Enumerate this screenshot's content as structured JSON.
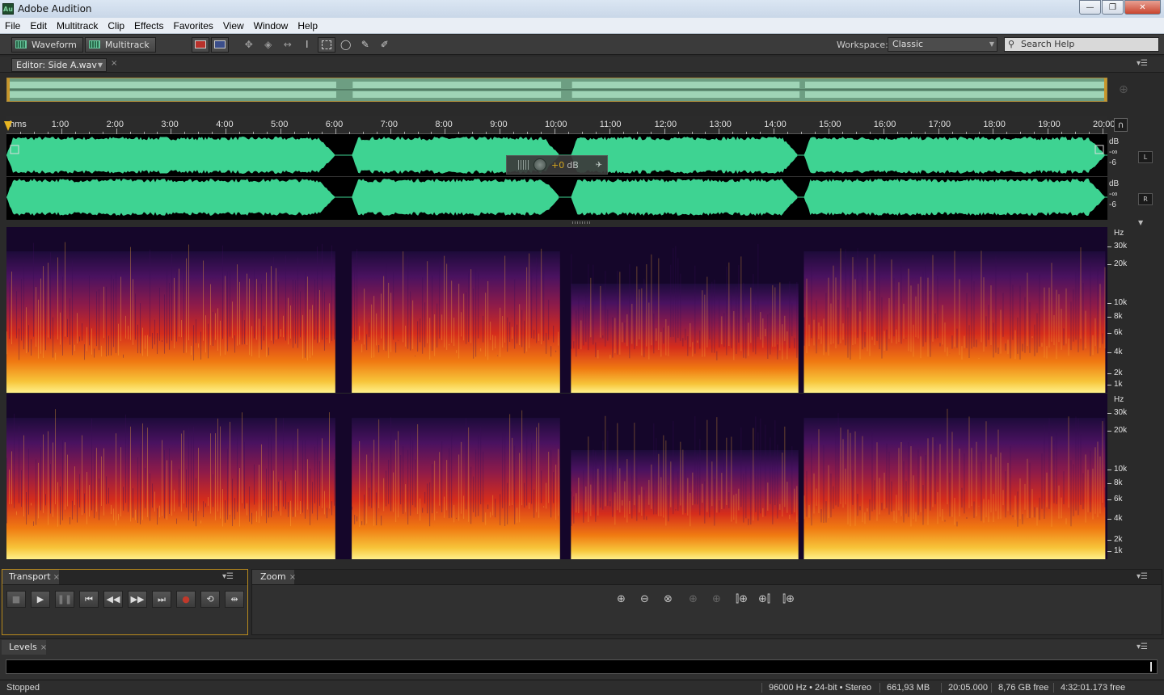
{
  "window": {
    "title": "Adobe Audition",
    "icon_text": "Au",
    "minimize": "—",
    "maximize": "❐",
    "close": "✕"
  },
  "menu": [
    "File",
    "Edit",
    "Multitrack",
    "Clip",
    "Effects",
    "Favorites",
    "View",
    "Window",
    "Help"
  ],
  "toolbar": {
    "waveform_label": "Waveform",
    "multitrack_label": "Multitrack",
    "workspace_label": "Workspace:",
    "workspace_value": "Classic",
    "search_placeholder": "Search Help",
    "tool_icons": [
      "spectral-display-icon",
      "spectral-pitch-icon",
      "move-tool-icon",
      "razor-tool-icon",
      "slip-tool-icon",
      "time-selection-icon",
      "marquee-selection-icon",
      "lasso-selection-icon",
      "paintbrush-selection-icon",
      "spot-healing-icon"
    ]
  },
  "editor": {
    "tab_label": "Editor: Side A.wav",
    "close": "×"
  },
  "ruler": {
    "unit": "hms",
    "labels": [
      "1:00",
      "2:00",
      "3:00",
      "4:00",
      "5:00",
      "6:00",
      "7:00",
      "8:00",
      "9:00",
      "10:00",
      "11:00",
      "12:00",
      "13:00",
      "14:00",
      "15:00",
      "16:00",
      "17:00",
      "18:00",
      "19:00",
      "20:00"
    ]
  },
  "waveform": {
    "db_label": "dB",
    "db_ticks": [
      "-∞",
      "-6"
    ],
    "channels": [
      "L",
      "R"
    ],
    "volume_hud_value": "+0",
    "volume_hud_unit": "dB",
    "segments_minutes": [
      [
        0,
        6.0
      ],
      [
        6.3,
        10.1
      ],
      [
        10.3,
        14.45
      ],
      [
        14.55,
        20.05
      ]
    ],
    "colors": {
      "wave": "#3ed392",
      "background": "#000000"
    }
  },
  "spectrogram": {
    "hz_label": "Hz",
    "freq_ticks": [
      "30k",
      "20k",
      "10k",
      "8k",
      "6k",
      "4k",
      "2k",
      "1k"
    ]
  },
  "transport": {
    "tab_label": "Transport",
    "close": "×",
    "buttons": [
      "stop-icon",
      "play-icon",
      "pause-icon",
      "go-to-start-icon",
      "rewind-icon",
      "fast-forward-icon",
      "go-to-end-icon",
      "record-icon",
      "loop-icon",
      "skip-selection-icon"
    ]
  },
  "zoom": {
    "tab_label": "Zoom",
    "close": "×",
    "buttons": [
      "zoom-in-amplitude-icon",
      "zoom-out-amplitude-icon",
      "zoom-out-full-icon",
      "zoom-in-point-icon",
      "zoom-selection-icon",
      "zoom-in-left-icon",
      "zoom-in-right-icon",
      "zoom-selection-both-icon"
    ]
  },
  "levels": {
    "tab_label": "Levels",
    "close": "×"
  },
  "status": {
    "state": "Stopped",
    "format": "96000 Hz • 24-bit • Stereo",
    "size": "661,93 MB",
    "duration": "20:05.000",
    "disk_free": "8,76 GB free",
    "time_free": "4:32:01.173 free"
  }
}
